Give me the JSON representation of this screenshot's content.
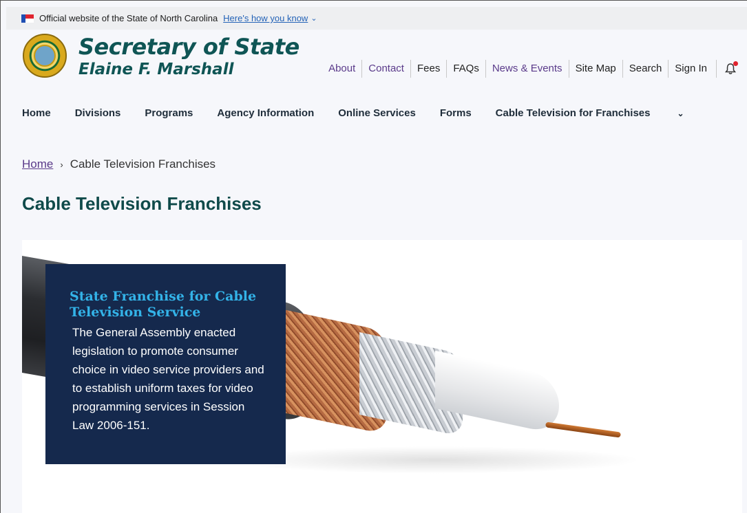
{
  "banner": {
    "official_text": "Official website of the State of North Carolina",
    "how_link": "Here's how you know"
  },
  "header": {
    "title": "Secretary of State",
    "subtitle": "Elaine F. Marshall"
  },
  "utility_nav": {
    "about": "About",
    "contact": "Contact",
    "fees": "Fees",
    "faqs": "FAQs",
    "news": "News & Events",
    "sitemap": "Site Map",
    "search": "Search",
    "signin": "Sign In"
  },
  "main_nav": {
    "home": "Home",
    "divisions": "Divisions",
    "programs": "Programs",
    "agency": "Agency Information",
    "online": "Online Services",
    "forms": "Forms",
    "cable": "Cable Television for Franchises"
  },
  "breadcrumb": {
    "home": "Home",
    "current": "Cable Television Franchises"
  },
  "page": {
    "title": "Cable Television Franchises"
  },
  "hero": {
    "box_title": "State Franchise for Cable Television Service",
    "box_text": "The General Assembly enacted legislation to promote consumer choice in video service providers and to establish uniform taxes for video programming services in Session Law 2006-151."
  },
  "icons": {
    "flag": "nc-flag-icon",
    "chevron": "chevron-down-icon",
    "bell": "notification-bell-icon",
    "seal": "state-seal-logo"
  },
  "colors": {
    "brand_teal": "#0f5555",
    "link_purple": "#5a3a8a",
    "hero_box": "#15294d",
    "hero_title": "#33b3e8"
  }
}
